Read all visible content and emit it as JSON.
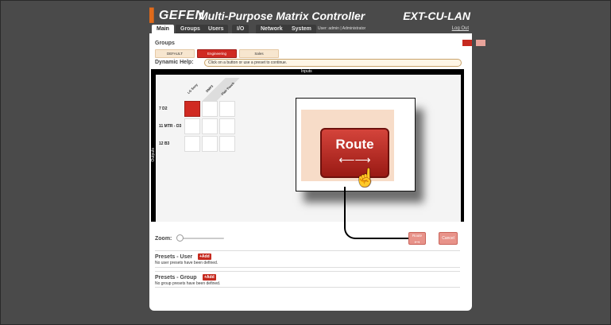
{
  "header": {
    "brand": "GEFEN",
    "app_title": "Multi-Purpose Matrix Controller",
    "model": "EXT-CU-LAN"
  },
  "tabs": [
    {
      "label": "Main",
      "active": true
    },
    {
      "label": "Groups",
      "active": false
    },
    {
      "label": "Users",
      "active": false
    },
    {
      "label": "I/O",
      "active": false
    },
    {
      "label": "Network",
      "active": false
    },
    {
      "label": "System",
      "active": false
    }
  ],
  "user_info": "User: admin  |  Administrator",
  "logout": "Log Out",
  "groups": {
    "title": "Groups",
    "items": [
      {
        "label": "DEFAULT",
        "active": false
      },
      {
        "label": "Engineering",
        "active": true
      },
      {
        "label": "Sales",
        "active": false
      }
    ]
  },
  "help": {
    "label": "Dynamic Help:",
    "text": "Click on a button or use a preset to continue."
  },
  "matrix": {
    "inputs_label": "Inputs",
    "outputs_label": "Outputs",
    "inputs": [
      "LG Sony",
      "DMP3",
      "Flair Touch"
    ],
    "outputs": [
      "7 D2",
      "11 MTR - D3",
      "12 B3"
    ],
    "routes": [
      [
        true,
        false,
        false
      ],
      [
        false,
        false,
        false
      ],
      [
        false,
        false,
        false
      ]
    ]
  },
  "callout": {
    "button_label": "Route"
  },
  "zoom": {
    "label": "Zoom:",
    "value": 0
  },
  "actions": {
    "route_label": "Route",
    "cancel_label": "Cancel"
  },
  "presets_user": {
    "title": "Presets - User",
    "add_label": "+Add",
    "note": "No user presets have been defined."
  },
  "presets_group": {
    "title": "Presets - Group",
    "add_label": "+Add",
    "note": "No group presets have been defined."
  },
  "colors": {
    "accent": "#c62a1f",
    "background": "#4a4a4a",
    "brand_orange": "#e06a1a"
  }
}
